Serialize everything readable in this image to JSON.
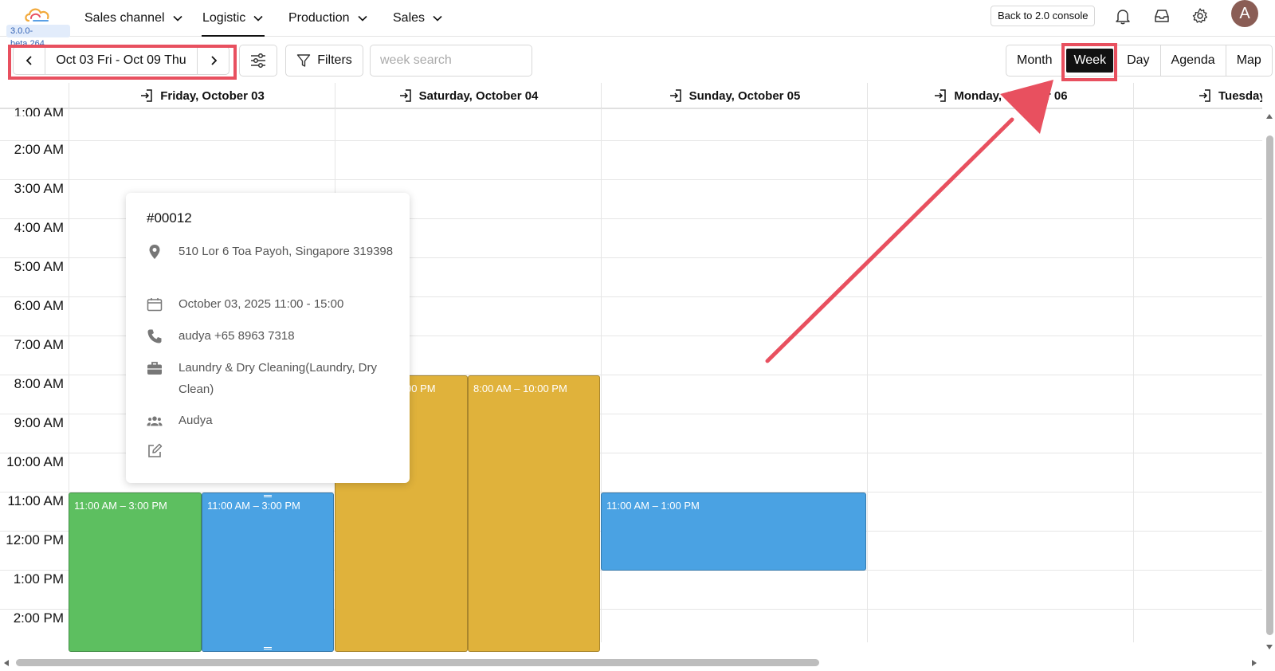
{
  "app": {
    "version": "3.0.0-beta.264"
  },
  "nav": {
    "items": [
      {
        "label": "Sales channel"
      },
      {
        "label": "Logistic"
      },
      {
        "label": "Production"
      },
      {
        "label": "Sales"
      }
    ],
    "active": "Logistic",
    "console_label": "Back to 2.0 console",
    "avatar_initial": "A"
  },
  "toolbar": {
    "date_range": "Oct 03 Fri - Oct 09 Thu",
    "filters_label": "Filters",
    "search_placeholder": "week search",
    "views": [
      "Month",
      "Week",
      "Day",
      "Agenda",
      "Map"
    ],
    "active_view": "Week"
  },
  "calendar": {
    "days": [
      "Friday, October 03",
      "Saturday, October 04",
      "Sunday, October 05",
      "Monday, October 06",
      "Tuesday"
    ],
    "times": [
      "1:00 AM",
      "2:00 AM",
      "3:00 AM",
      "4:00 AM",
      "5:00 AM",
      "6:00 AM",
      "7:00 AM",
      "8:00 AM",
      "9:00 AM",
      "10:00 AM",
      "11:00 AM",
      "12:00 PM",
      "1:00 PM",
      "2:00 PM"
    ],
    "events": [
      {
        "label": "11:00 AM – 3:00 PM",
        "color": "#5dbf60"
      },
      {
        "label": "11:00 AM – 3:00 PM",
        "color": "#4aa2e3"
      },
      {
        "label": "00 PM",
        "color": "#e0b23b"
      },
      {
        "label": "8:00 AM – 10:00 PM",
        "color": "#e0b23b"
      },
      {
        "label": "11:00 AM – 1:00 PM",
        "color": "#4aa2e3"
      }
    ]
  },
  "popup": {
    "title": "#00012",
    "address": "510 Lor 6 Toa Payoh, Singapore 319398",
    "datetime": "October 03, 2025 11:00 - 15:00",
    "phone": "audya +65 8963 7318",
    "service": "Laundry & Dry Cleaning(Laundry, Dry Clean)",
    "team": "Audya"
  },
  "annotation_color": "#e8505f"
}
